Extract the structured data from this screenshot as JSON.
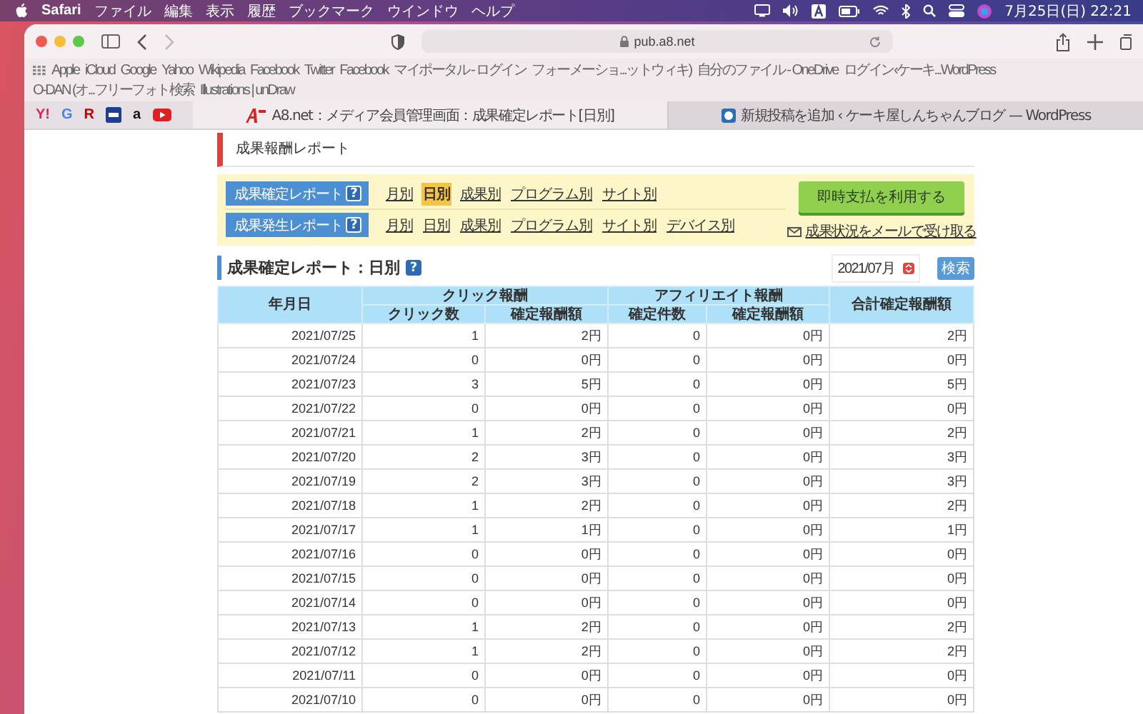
{
  "menubar": {
    "app": "Safari",
    "menus": [
      "ファイル",
      "編集",
      "表示",
      "履歴",
      "ブックマーク",
      "ウインドウ",
      "ヘルプ"
    ],
    "clock": "7月25日(日)  22:21"
  },
  "browser": {
    "address": "pub.a8.net",
    "bookmarks": [
      "Apple",
      "iCloud",
      "Google",
      "Yahoo",
      "Wikipedia",
      "Facebook",
      "Twitter",
      "Facebook",
      "マイポータル - ログイン",
      "フォーメーショ...ットウィキ)",
      "自分のファイル - OneDrive",
      "ログイン‹ケーキ...WordPress",
      "O-DAN (オ...フリーフォト検索",
      "Illustrations | unDraw"
    ],
    "favorites": [
      {
        "kind": "text",
        "label": "Y!",
        "color": "#e0205a"
      },
      {
        "kind": "text",
        "label": "G",
        "color": "#4285f4"
      },
      {
        "kind": "text",
        "label": "R",
        "color": "#bf0000"
      },
      {
        "kind": "grid",
        "color": "#1d3f8f"
      },
      {
        "kind": "text",
        "label": "a",
        "color": "#111111"
      },
      {
        "kind": "play",
        "color": "#e02020"
      }
    ],
    "tabs": [
      {
        "title": "A8.net：メディア会員管理画面：成果確定レポート[日別]",
        "selected": true
      },
      {
        "title": "新規投稿を追加 ‹ ケーキ屋しんちゃんブログ — WordPress",
        "selected": false
      }
    ]
  },
  "page": {
    "section_title": "成果報酬レポート",
    "reports": [
      {
        "label": "成果確定レポート",
        "help": "?",
        "links": [
          {
            "label": "月別",
            "selected": false
          },
          {
            "label": "日別",
            "selected": true
          },
          {
            "label": "成果別",
            "selected": false
          },
          {
            "label": "プログラム別",
            "selected": false
          },
          {
            "label": "サイト別",
            "selected": false
          }
        ]
      },
      {
        "label": "成果発生レポート",
        "help": "?",
        "links": [
          {
            "label": "月別",
            "selected": false
          },
          {
            "label": "日別",
            "selected": false
          },
          {
            "label": "成果別",
            "selected": false
          },
          {
            "label": "プログラム別",
            "selected": false
          },
          {
            "label": "サイト別",
            "selected": false
          },
          {
            "label": "デバイス別",
            "selected": false
          }
        ]
      }
    ],
    "instant_button": "即時支払を利用する",
    "mail_link": "成果状況をメールで受け取る",
    "report_title": "成果確定レポート：日別",
    "report_help": "?",
    "month_select": "2021/07月",
    "search_button": "検索",
    "table": {
      "date_header": "年月日",
      "groups": [
        {
          "title": "クリック報酬",
          "columns": [
            "クリック数",
            "確定報酬額"
          ]
        },
        {
          "title": "アフィリエイト報酬",
          "columns": [
            "確定件数",
            "確定報酬額"
          ]
        }
      ],
      "total_header": "合計確定報酬額",
      "rows": [
        [
          "2021/07/25",
          "1",
          "2円",
          "0",
          "0円",
          "2円"
        ],
        [
          "2021/07/24",
          "0",
          "0円",
          "0",
          "0円",
          "0円"
        ],
        [
          "2021/07/23",
          "3",
          "5円",
          "0",
          "0円",
          "5円"
        ],
        [
          "2021/07/22",
          "0",
          "0円",
          "0",
          "0円",
          "0円"
        ],
        [
          "2021/07/21",
          "1",
          "2円",
          "0",
          "0円",
          "2円"
        ],
        [
          "2021/07/20",
          "2",
          "3円",
          "0",
          "0円",
          "3円"
        ],
        [
          "2021/07/19",
          "2",
          "3円",
          "0",
          "0円",
          "3円"
        ],
        [
          "2021/07/18",
          "1",
          "2円",
          "0",
          "0円",
          "2円"
        ],
        [
          "2021/07/17",
          "1",
          "1円",
          "0",
          "0円",
          "1円"
        ],
        [
          "2021/07/16",
          "0",
          "0円",
          "0",
          "0円",
          "0円"
        ],
        [
          "2021/07/15",
          "0",
          "0円",
          "0",
          "0円",
          "0円"
        ],
        [
          "2021/07/14",
          "0",
          "0円",
          "0",
          "0円",
          "0円"
        ],
        [
          "2021/07/13",
          "1",
          "2円",
          "0",
          "0円",
          "2円"
        ],
        [
          "2021/07/12",
          "1",
          "2円",
          "0",
          "0円",
          "2円"
        ],
        [
          "2021/07/11",
          "0",
          "0円",
          "0",
          "0円",
          "0円"
        ],
        [
          "2021/07/10",
          "0",
          "0円",
          "0",
          "0円",
          "0円"
        ]
      ]
    }
  }
}
